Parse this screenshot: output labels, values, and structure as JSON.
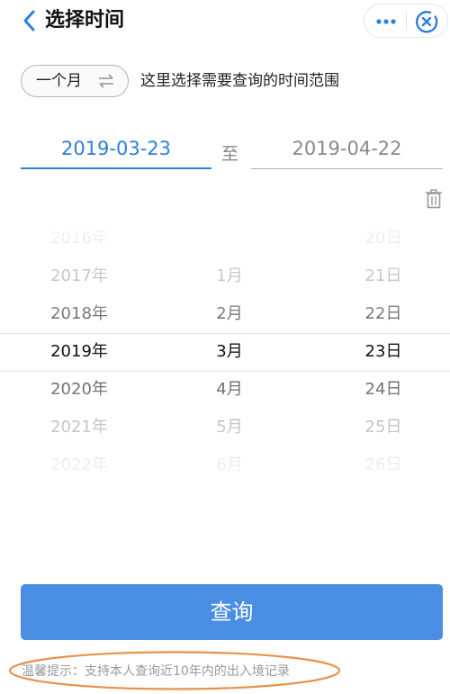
{
  "header": {
    "title": "选择时间",
    "back_icon": "chevron-left-icon",
    "more_icon": "more-dots-icon",
    "close_icon": "close-circle-icon",
    "accent_color": "#2e7fd9"
  },
  "range": {
    "label": "一个月",
    "swap_glyph": "⇌",
    "hint": "这里选择需要查询的时间范围"
  },
  "dates": {
    "start": "2019-03-23",
    "separator": "至",
    "end": "2019-04-22"
  },
  "picker": {
    "years": [
      "2016年",
      "2017年",
      "2018年",
      "2019年",
      "2020年",
      "2021年",
      "2022年"
    ],
    "months": [
      "",
      "1月",
      "2月",
      "3月",
      "4月",
      "5月",
      "6月"
    ],
    "days": [
      "20日",
      "21日",
      "22日",
      "23日",
      "24日",
      "25日",
      "26日"
    ],
    "selected_index": 3
  },
  "actions": {
    "query_label": "查询",
    "button_color": "#4a8ee3"
  },
  "tip": {
    "text": "温馨提示：支持本人查询近10年内的出入境记录",
    "highlight_color": "#e8924a"
  }
}
